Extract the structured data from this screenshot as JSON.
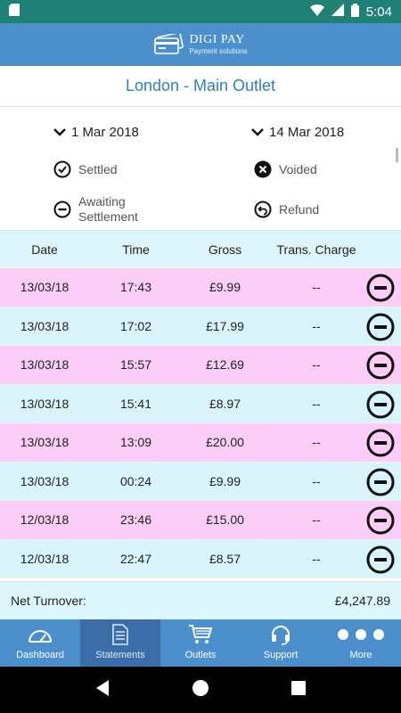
{
  "status_bar": {
    "time": "5:04"
  },
  "header": {
    "logo_title": "DIGI PAY",
    "logo_subtitle": "Payment solutions"
  },
  "outlet": {
    "title": "London - Main Outlet"
  },
  "filters": {
    "date_from": "1 Mar 2018",
    "date_to": "14 Mar 2018",
    "legend": {
      "settled": "Settled",
      "voided": "Voided",
      "awaiting": "Awaiting Settlement",
      "refund": "Refund"
    }
  },
  "table": {
    "headers": {
      "date": "Date",
      "time": "Time",
      "gross": "Gross",
      "charge": "Trans. Charge"
    },
    "rows": [
      {
        "date": "13/03/18",
        "time": "17:43",
        "gross": "£9.99",
        "charge": "--",
        "status": "awaiting"
      },
      {
        "date": "13/03/18",
        "time": "17:02",
        "gross": "£17.99",
        "charge": "--",
        "status": "awaiting"
      },
      {
        "date": "13/03/18",
        "time": "15:57",
        "gross": "£12.69",
        "charge": "--",
        "status": "awaiting"
      },
      {
        "date": "13/03/18",
        "time": "15:41",
        "gross": "£8.97",
        "charge": "--",
        "status": "awaiting"
      },
      {
        "date": "13/03/18",
        "time": "13:09",
        "gross": "£20.00",
        "charge": "--",
        "status": "awaiting"
      },
      {
        "date": "13/03/18",
        "time": "00:24",
        "gross": "£9.99",
        "charge": "--",
        "status": "awaiting"
      },
      {
        "date": "12/03/18",
        "time": "23:46",
        "gross": "£15.00",
        "charge": "--",
        "status": "awaiting"
      },
      {
        "date": "12/03/18",
        "time": "22:47",
        "gross": "£8.57",
        "charge": "--",
        "status": "awaiting"
      }
    ]
  },
  "summary": {
    "label": "Net Turnover:",
    "value": "£4,247.89"
  },
  "tabs": [
    {
      "label": "Dashboard",
      "icon": "gauge-icon"
    },
    {
      "label": "Statements",
      "icon": "document-icon",
      "active": true
    },
    {
      "label": "Outlets",
      "icon": "cart-icon"
    },
    {
      "label": "Support",
      "icon": "headset-icon"
    },
    {
      "label": "More",
      "icon": "more-dots-icon"
    }
  ],
  "colors": {
    "status_bar": "#1f8075",
    "header": "#4b8fcc",
    "title": "#2f7fc1",
    "row_pink": "#fbcdf7",
    "row_blue": "#d9f4fa"
  }
}
